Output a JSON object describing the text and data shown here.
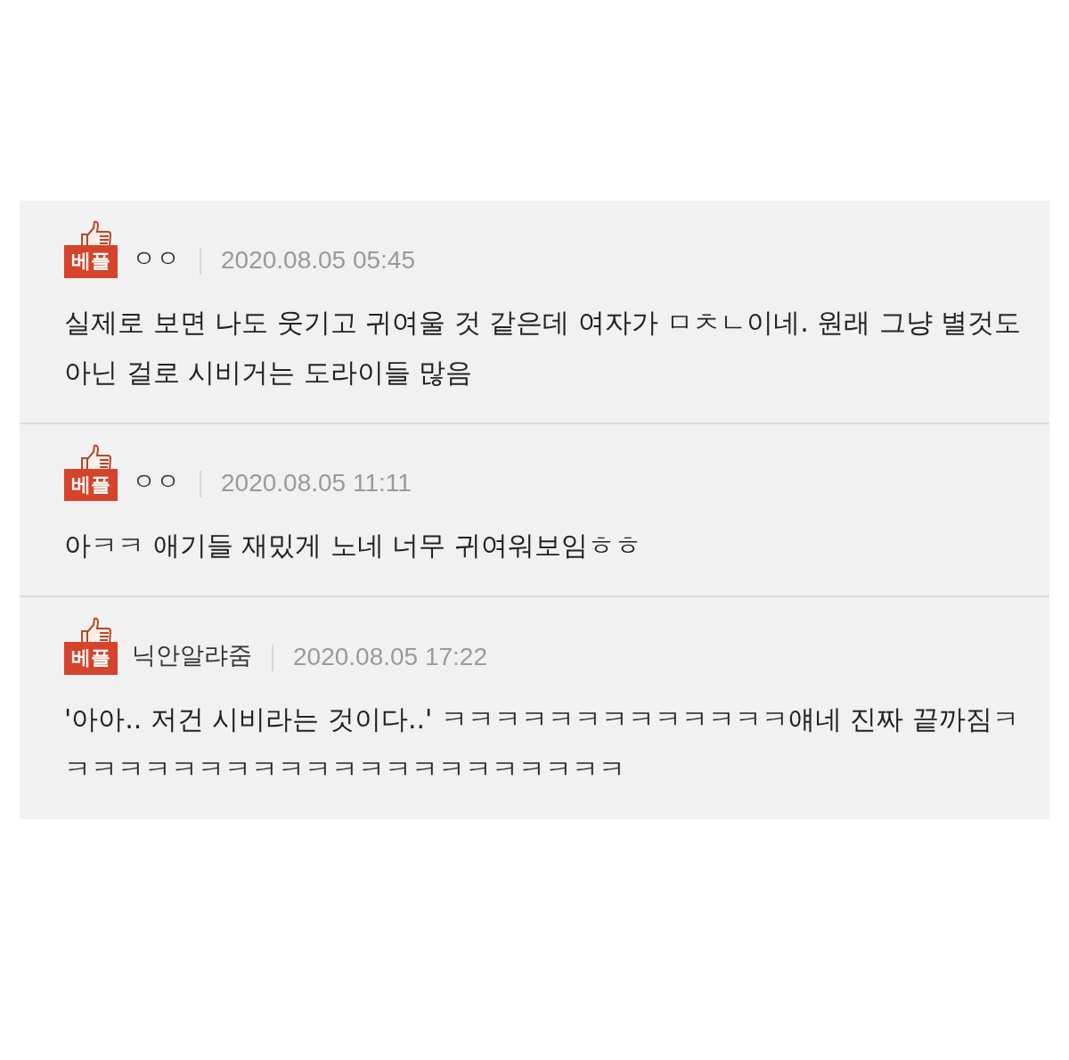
{
  "comments": [
    {
      "badge": "베플",
      "author": "ㅇㅇ",
      "date": "2020.08.05 05:45",
      "text": "실제로 보면 나도 웃기고 귀여울 것 같은데 여자가 ㅁㅊㄴ이네. 원래 그냥 별것도 아닌 걸로 시비거는 도라이들 많음"
    },
    {
      "badge": "베플",
      "author": "ㅇㅇ",
      "date": "2020.08.05 11:11",
      "text": "아ㅋㅋ 애기들 재밌게 노네 너무 귀여워보임ㅎㅎ"
    },
    {
      "badge": "베플",
      "author": "닉안알랴줌",
      "date": "2020.08.05 17:22",
      "text": "'아아.. 저건 시비라는 것이다..' ㅋㅋㅋㅋㅋㅋㅋㅋㅋㅋㅋㅋㅋ얘네 진짜 끝까짐ㅋㅋㅋㅋㅋㅋㅋㅋㅋㅋㅋㅋㅋㅋㅋㅋㅋㅋㅋㅋㅋㅋ"
    }
  ]
}
